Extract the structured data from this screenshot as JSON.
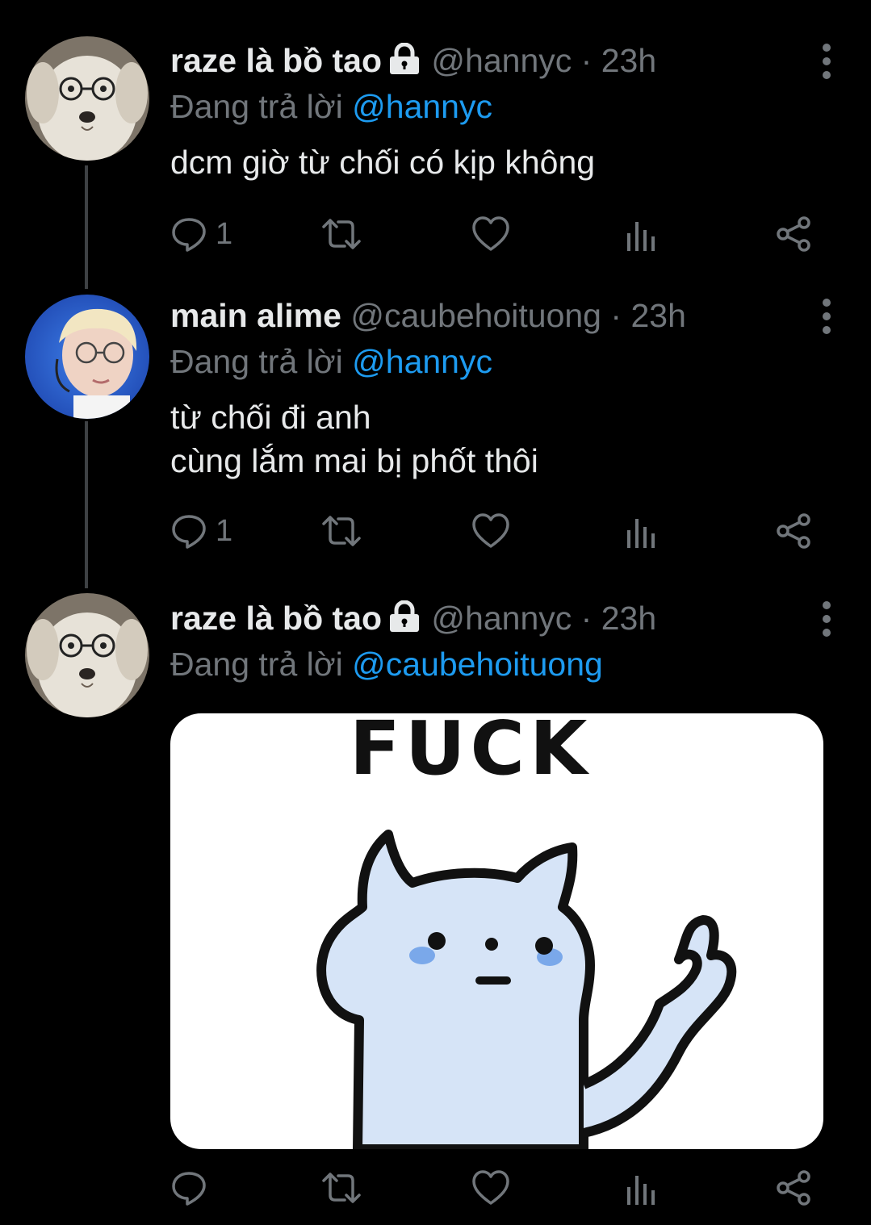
{
  "tweets": [
    {
      "name": "raze là bồ tao",
      "handle": "@hannyc",
      "separator": "·",
      "time": "23h",
      "reply_prefix": "Đang trả lời",
      "reply_to": "@hannyc",
      "text": "dcm giờ từ chối có kịp không",
      "reply_count": "1",
      "locked": true,
      "avatar_icon": "puppy-with-glasses-avatar"
    },
    {
      "name": "main alime",
      "handle": "@caubehoituong",
      "separator": "·",
      "time": "23h",
      "reply_prefix": "Đang trả lời",
      "reply_to": "@hannyc",
      "text_line1": "từ chối đi anh",
      "text_line2": "cùng lắm mai bị phốt thôi",
      "reply_count": "1",
      "locked": false,
      "avatar_icon": "blond-person-with-glasses-avatar"
    },
    {
      "name": "raze là bồ tao",
      "handle": "@hannyc",
      "separator": "·",
      "time": "23h",
      "reply_prefix": "Đang trả lời",
      "reply_to": "@caubehoituong",
      "media_caption": "FUCK",
      "media_icon": "white-cat-middle-finger-sticker",
      "locked": true,
      "avatar_icon": "puppy-with-glasses-avatar"
    }
  ],
  "colors": {
    "background": "#000000",
    "text": "#e7e9ea",
    "secondary": "#71767b",
    "accent": "#1d9bf0",
    "thread_line": "#3e4144"
  },
  "icons": [
    "reply-icon",
    "retweet-icon",
    "like-icon",
    "analytics-icon",
    "share-icon",
    "more-icon",
    "lock-icon"
  ]
}
